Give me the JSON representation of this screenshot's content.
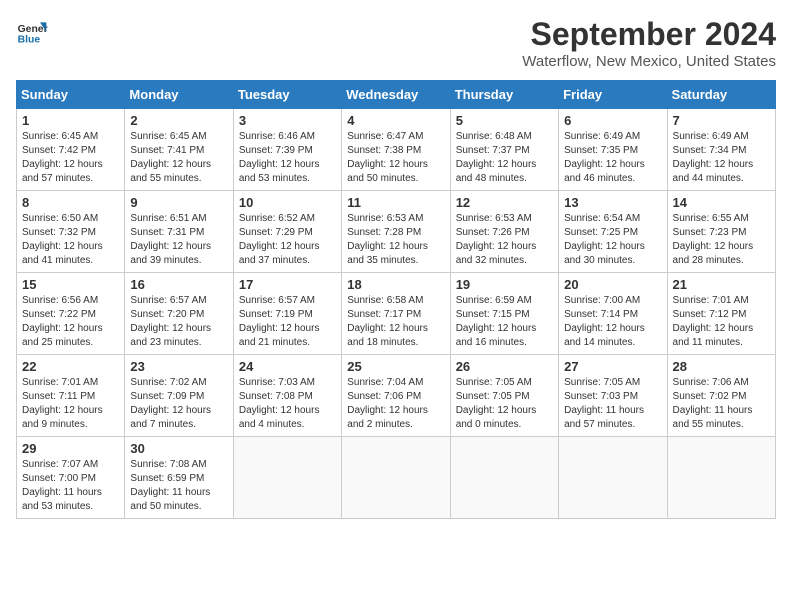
{
  "header": {
    "logo_general": "General",
    "logo_blue": "Blue",
    "title": "September 2024",
    "location": "Waterflow, New Mexico, United States"
  },
  "calendar": {
    "days_of_week": [
      "Sunday",
      "Monday",
      "Tuesday",
      "Wednesday",
      "Thursday",
      "Friday",
      "Saturday"
    ],
    "weeks": [
      [
        {
          "day": "1",
          "lines": [
            "Sunrise: 6:45 AM",
            "Sunset: 7:42 PM",
            "Daylight: 12 hours",
            "and 57 minutes."
          ]
        },
        {
          "day": "2",
          "lines": [
            "Sunrise: 6:45 AM",
            "Sunset: 7:41 PM",
            "Daylight: 12 hours",
            "and 55 minutes."
          ]
        },
        {
          "day": "3",
          "lines": [
            "Sunrise: 6:46 AM",
            "Sunset: 7:39 PM",
            "Daylight: 12 hours",
            "and 53 minutes."
          ]
        },
        {
          "day": "4",
          "lines": [
            "Sunrise: 6:47 AM",
            "Sunset: 7:38 PM",
            "Daylight: 12 hours",
            "and 50 minutes."
          ]
        },
        {
          "day": "5",
          "lines": [
            "Sunrise: 6:48 AM",
            "Sunset: 7:37 PM",
            "Daylight: 12 hours",
            "and 48 minutes."
          ]
        },
        {
          "day": "6",
          "lines": [
            "Sunrise: 6:49 AM",
            "Sunset: 7:35 PM",
            "Daylight: 12 hours",
            "and 46 minutes."
          ]
        },
        {
          "day": "7",
          "lines": [
            "Sunrise: 6:49 AM",
            "Sunset: 7:34 PM",
            "Daylight: 12 hours",
            "and 44 minutes."
          ]
        }
      ],
      [
        {
          "day": "8",
          "lines": [
            "Sunrise: 6:50 AM",
            "Sunset: 7:32 PM",
            "Daylight: 12 hours",
            "and 41 minutes."
          ]
        },
        {
          "day": "9",
          "lines": [
            "Sunrise: 6:51 AM",
            "Sunset: 7:31 PM",
            "Daylight: 12 hours",
            "and 39 minutes."
          ]
        },
        {
          "day": "10",
          "lines": [
            "Sunrise: 6:52 AM",
            "Sunset: 7:29 PM",
            "Daylight: 12 hours",
            "and 37 minutes."
          ]
        },
        {
          "day": "11",
          "lines": [
            "Sunrise: 6:53 AM",
            "Sunset: 7:28 PM",
            "Daylight: 12 hours",
            "and 35 minutes."
          ]
        },
        {
          "day": "12",
          "lines": [
            "Sunrise: 6:53 AM",
            "Sunset: 7:26 PM",
            "Daylight: 12 hours",
            "and 32 minutes."
          ]
        },
        {
          "day": "13",
          "lines": [
            "Sunrise: 6:54 AM",
            "Sunset: 7:25 PM",
            "Daylight: 12 hours",
            "and 30 minutes."
          ]
        },
        {
          "day": "14",
          "lines": [
            "Sunrise: 6:55 AM",
            "Sunset: 7:23 PM",
            "Daylight: 12 hours",
            "and 28 minutes."
          ]
        }
      ],
      [
        {
          "day": "15",
          "lines": [
            "Sunrise: 6:56 AM",
            "Sunset: 7:22 PM",
            "Daylight: 12 hours",
            "and 25 minutes."
          ]
        },
        {
          "day": "16",
          "lines": [
            "Sunrise: 6:57 AM",
            "Sunset: 7:20 PM",
            "Daylight: 12 hours",
            "and 23 minutes."
          ]
        },
        {
          "day": "17",
          "lines": [
            "Sunrise: 6:57 AM",
            "Sunset: 7:19 PM",
            "Daylight: 12 hours",
            "and 21 minutes."
          ]
        },
        {
          "day": "18",
          "lines": [
            "Sunrise: 6:58 AM",
            "Sunset: 7:17 PM",
            "Daylight: 12 hours",
            "and 18 minutes."
          ]
        },
        {
          "day": "19",
          "lines": [
            "Sunrise: 6:59 AM",
            "Sunset: 7:15 PM",
            "Daylight: 12 hours",
            "and 16 minutes."
          ]
        },
        {
          "day": "20",
          "lines": [
            "Sunrise: 7:00 AM",
            "Sunset: 7:14 PM",
            "Daylight: 12 hours",
            "and 14 minutes."
          ]
        },
        {
          "day": "21",
          "lines": [
            "Sunrise: 7:01 AM",
            "Sunset: 7:12 PM",
            "Daylight: 12 hours",
            "and 11 minutes."
          ]
        }
      ],
      [
        {
          "day": "22",
          "lines": [
            "Sunrise: 7:01 AM",
            "Sunset: 7:11 PM",
            "Daylight: 12 hours",
            "and 9 minutes."
          ]
        },
        {
          "day": "23",
          "lines": [
            "Sunrise: 7:02 AM",
            "Sunset: 7:09 PM",
            "Daylight: 12 hours",
            "and 7 minutes."
          ]
        },
        {
          "day": "24",
          "lines": [
            "Sunrise: 7:03 AM",
            "Sunset: 7:08 PM",
            "Daylight: 12 hours",
            "and 4 minutes."
          ]
        },
        {
          "day": "25",
          "lines": [
            "Sunrise: 7:04 AM",
            "Sunset: 7:06 PM",
            "Daylight: 12 hours",
            "and 2 minutes."
          ]
        },
        {
          "day": "26",
          "lines": [
            "Sunrise: 7:05 AM",
            "Sunset: 7:05 PM",
            "Daylight: 12 hours",
            "and 0 minutes."
          ]
        },
        {
          "day": "27",
          "lines": [
            "Sunrise: 7:05 AM",
            "Sunset: 7:03 PM",
            "Daylight: 11 hours",
            "and 57 minutes."
          ]
        },
        {
          "day": "28",
          "lines": [
            "Sunrise: 7:06 AM",
            "Sunset: 7:02 PM",
            "Daylight: 11 hours",
            "and 55 minutes."
          ]
        }
      ],
      [
        {
          "day": "29",
          "lines": [
            "Sunrise: 7:07 AM",
            "Sunset: 7:00 PM",
            "Daylight: 11 hours",
            "and 53 minutes."
          ]
        },
        {
          "day": "30",
          "lines": [
            "Sunrise: 7:08 AM",
            "Sunset: 6:59 PM",
            "Daylight: 11 hours",
            "and 50 minutes."
          ]
        },
        null,
        null,
        null,
        null,
        null
      ]
    ]
  }
}
